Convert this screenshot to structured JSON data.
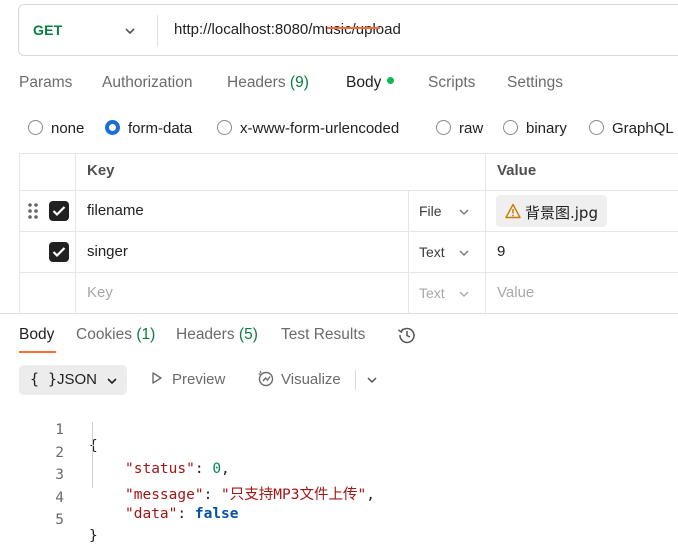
{
  "request": {
    "method": "GET",
    "url": "http://localhost:8080/music/upload"
  },
  "request_tabs": [
    {
      "label": "Params"
    },
    {
      "label": "Authorization"
    },
    {
      "label": "Headers",
      "count": "(9)"
    },
    {
      "label": "Body",
      "active": true
    },
    {
      "label": "Scripts"
    },
    {
      "label": "Settings"
    }
  ],
  "body_types": [
    {
      "label": "none",
      "selected": false
    },
    {
      "label": "form-data",
      "selected": true
    },
    {
      "label": "x-www-form-urlencoded",
      "selected": false
    },
    {
      "label": "raw",
      "selected": false
    },
    {
      "label": "binary",
      "selected": false
    },
    {
      "label": "GraphQL",
      "selected": false
    }
  ],
  "table": {
    "headers": {
      "key": "Key",
      "value": "Value"
    },
    "rows": [
      {
        "checked": true,
        "key": "filename",
        "type": "File",
        "value": "背景图.jpg",
        "value_warning": true
      },
      {
        "checked": true,
        "key": "singer",
        "type": "Text",
        "value": "9"
      }
    ],
    "new_row": {
      "key_placeholder": "Key",
      "type": "Text",
      "value_placeholder": "Value"
    }
  },
  "response_tabs": [
    {
      "label": "Body",
      "active": true
    },
    {
      "label": "Cookies",
      "count": "(1)"
    },
    {
      "label": "Headers",
      "count": "(5)"
    },
    {
      "label": "Test Results"
    }
  ],
  "response_toolbar": {
    "format_label": "JSON",
    "format_icon": "{ }",
    "preview_label": "Preview",
    "visualize_label": "Visualize"
  },
  "response_body": {
    "line_numbers": [
      "1",
      "2",
      "3",
      "4",
      "5"
    ],
    "open_brace": "{",
    "close_brace": "}",
    "fields": [
      {
        "key": "\"status\"",
        "value": "0",
        "kind": "number",
        "comma": ","
      },
      {
        "key": "\"message\"",
        "value": "\"只支持MP3文件上传\"",
        "kind": "string",
        "comma": ","
      },
      {
        "key": "\"data\"",
        "value": "false",
        "kind": "bool",
        "comma": ""
      }
    ]
  },
  "colors": {
    "method": "#0a7d3f",
    "accent": "#ff6c37",
    "active_dot": "#0cbb52",
    "radio_selected": "#1a6fd6",
    "warning": "#c77d00"
  }
}
